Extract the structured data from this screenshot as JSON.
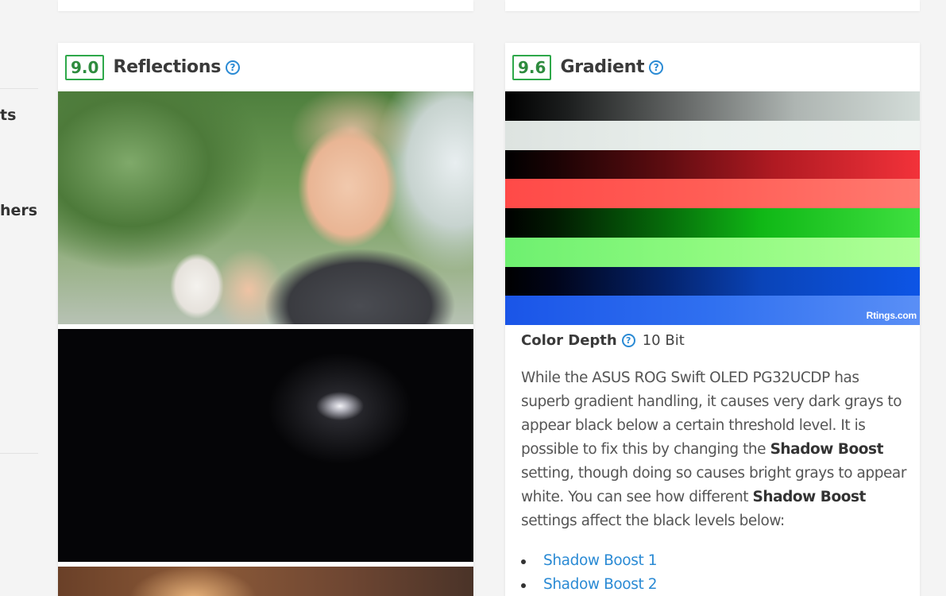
{
  "sidenav": {
    "items": [
      {
        "text": "ts"
      },
      {
        "text": "hers"
      }
    ]
  },
  "reflections": {
    "score": "9.0",
    "title": "Reflections",
    "help_glyph": "?"
  },
  "gradient": {
    "score": "9.6",
    "title": "Gradient",
    "help_glyph": "?",
    "watermark": "Rtings.com",
    "color_depth": {
      "label": "Color Depth",
      "help_glyph": "?",
      "value": "10 Bit"
    },
    "paragraph": {
      "p1": "While the ASUS ROG Swift OLED PG32UCDP has superb gradient handling, it causes very dark grays to appear black below a certain threshold level. It is possible to fix this by changing the ",
      "b1": "Shadow Boost",
      "p2": " setting, though doing so causes bright grays to appear white. You can see how different ",
      "b2": "Shadow Boost",
      "p3": " settings affect the black levels below:"
    },
    "links": [
      "Shadow Boost 1",
      "Shadow Boost 2"
    ]
  },
  "colors": {
    "score_border": "#2ea84a",
    "link": "#2a8ad4",
    "help_icon": "#2a8ad4"
  }
}
